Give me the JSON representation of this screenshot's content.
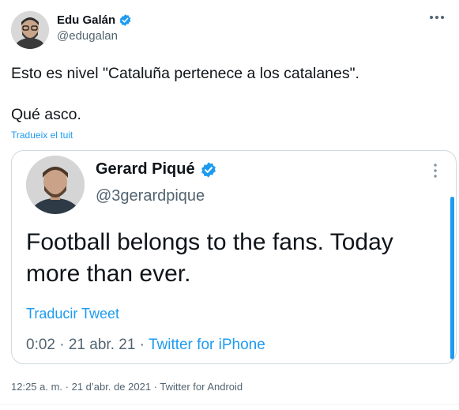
{
  "author": {
    "name": "Edu Galán",
    "handle": "@edugalan",
    "verified": true
  },
  "tweet": {
    "text": "Esto es nivel \"Cataluña pertenece a los catalanes\".\n\nQué asco.",
    "translate_label": "Tradueix el tuit",
    "meta": "12:25 a. m. · 21 d’abr. de 2021 · Twitter for Android"
  },
  "quoted_tweet": {
    "author_name": "Gerard Piqué",
    "author_handle": "@3gerardpique",
    "verified": true,
    "text": "Football belongs to the fans. Today more than ever.",
    "translate_label": "Traducir Tweet",
    "time": "0:02 · 21 abr. 21 · ",
    "source": "Twitter for iPhone"
  },
  "icons": {
    "verified": "verified-badge-icon",
    "more": "more-dots-icon"
  },
  "colors": {
    "accent": "#1d9bf0",
    "secondary_text": "#536471",
    "border": "#cfd9de"
  }
}
